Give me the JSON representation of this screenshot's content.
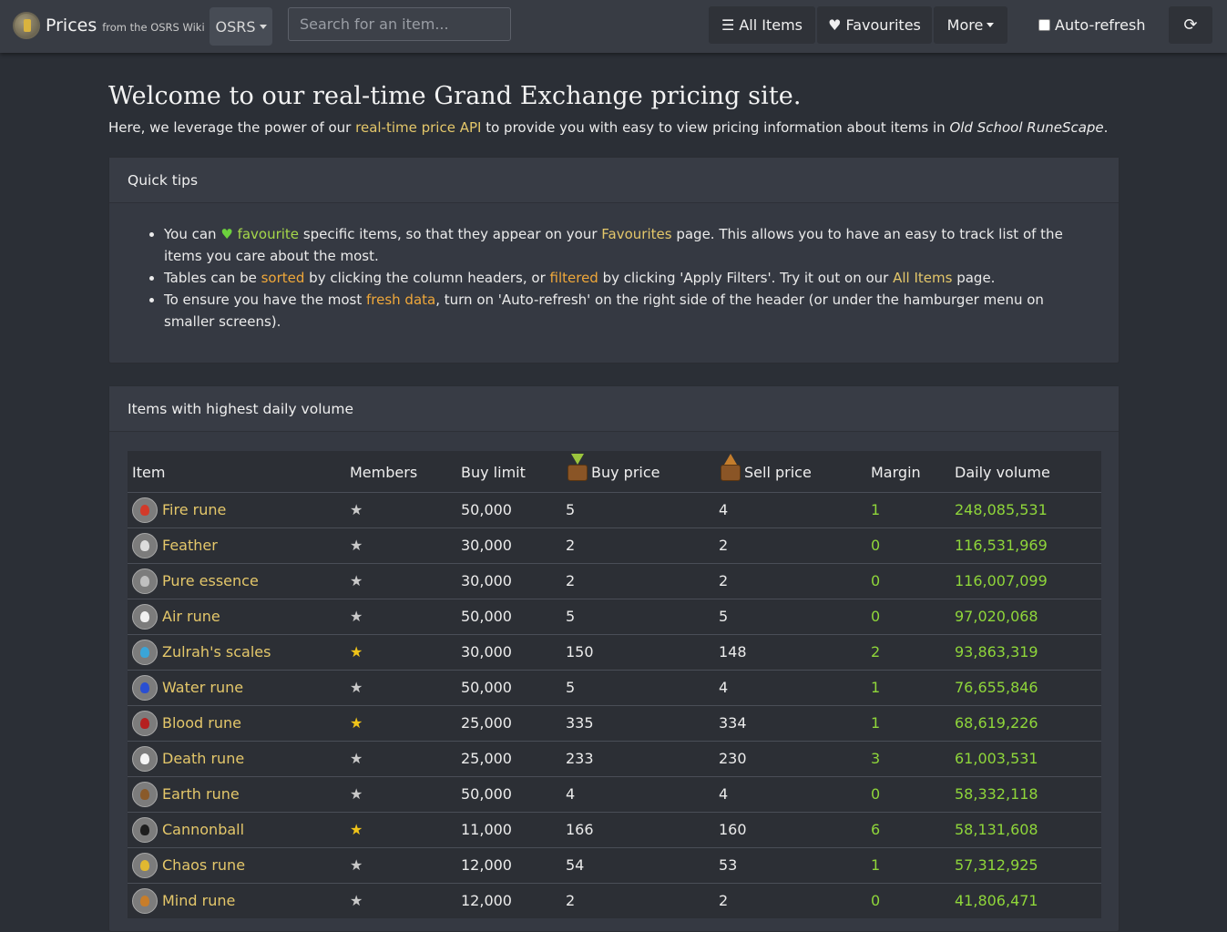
{
  "nav": {
    "brand_title": "Prices",
    "brand_subtitle": "from the OSRS Wiki",
    "game_select": "OSRS",
    "search_placeholder": "Search for an item...",
    "all_items": "All Items",
    "favourites": "Favourites",
    "more": "More",
    "auto_refresh": "Auto-refresh"
  },
  "welcome": {
    "title": "Welcome to our real-time Grand Exchange pricing site.",
    "intro_before": "Here, we leverage the power of our ",
    "intro_link": "real-time price API",
    "intro_middle": " to provide you with easy to view pricing information about items in ",
    "intro_game": "Old School RuneScape",
    "intro_end": "."
  },
  "tips": {
    "header": "Quick tips",
    "tip1_a": "You can ",
    "tip1_link": "favourite",
    "tip1_b": " specific items, so that they appear on your ",
    "tip1_link2": "Favourites",
    "tip1_c": " page. This allows you to have an easy to track list of the items you care about the most.",
    "tip2_a": "Tables can be ",
    "tip2_link": "sorted",
    "tip2_b": " by clicking the column headers, or ",
    "tip2_link2": "filtered",
    "tip2_c": " by clicking 'Apply Filters'. Try it out on our ",
    "tip2_link3": "All Items",
    "tip2_d": " page.",
    "tip3_a": "To ensure you have the most ",
    "tip3_link": "fresh data",
    "tip3_b": ", turn on 'Auto-refresh' on the right side of the header (or under the hamburger menu on smaller screens)."
  },
  "volume": {
    "header": "Items with highest daily volume",
    "columns": [
      "Item",
      "Members",
      "Buy limit",
      "Buy price",
      "Sell price",
      "Margin",
      "Daily volume"
    ],
    "rows": [
      {
        "name": "Fire rune",
        "members": false,
        "limit": "50,000",
        "buy": "5",
        "sell": "4",
        "margin": "1",
        "volume": "248,085,531",
        "icon": "fire-rune-icon",
        "color": "#d23a2a"
      },
      {
        "name": "Feather",
        "members": false,
        "limit": "30,000",
        "buy": "2",
        "sell": "2",
        "margin": "0",
        "volume": "116,531,969",
        "icon": "feather-icon",
        "color": "#dcdcdc"
      },
      {
        "name": "Pure essence",
        "members": false,
        "limit": "30,000",
        "buy": "2",
        "sell": "2",
        "margin": "0",
        "volume": "116,007,099",
        "icon": "pure-essence-icon",
        "color": "#bfbfbf"
      },
      {
        "name": "Air rune",
        "members": false,
        "limit": "50,000",
        "buy": "5",
        "sell": "5",
        "margin": "0",
        "volume": "97,020,068",
        "icon": "air-rune-icon",
        "color": "#f0f0f0"
      },
      {
        "name": "Zulrah's scales",
        "members": true,
        "limit": "30,000",
        "buy": "150",
        "sell": "148",
        "margin": "2",
        "volume": "93,863,319",
        "icon": "zulrahs-scales-icon",
        "color": "#3aa5d8"
      },
      {
        "name": "Water rune",
        "members": false,
        "limit": "50,000",
        "buy": "5",
        "sell": "4",
        "margin": "1",
        "volume": "76,655,846",
        "icon": "water-rune-icon",
        "color": "#2a4fd2"
      },
      {
        "name": "Blood rune",
        "members": true,
        "limit": "25,000",
        "buy": "335",
        "sell": "334",
        "margin": "1",
        "volume": "68,619,226",
        "icon": "blood-rune-icon",
        "color": "#b52020"
      },
      {
        "name": "Death rune",
        "members": false,
        "limit": "25,000",
        "buy": "233",
        "sell": "230",
        "margin": "3",
        "volume": "61,003,531",
        "icon": "death-rune-icon",
        "color": "#f5f5f5"
      },
      {
        "name": "Earth rune",
        "members": false,
        "limit": "50,000",
        "buy": "4",
        "sell": "4",
        "margin": "0",
        "volume": "58,332,118",
        "icon": "earth-rune-icon",
        "color": "#8a5a2a"
      },
      {
        "name": "Cannonball",
        "members": true,
        "limit": "11,000",
        "buy": "166",
        "sell": "160",
        "margin": "6",
        "volume": "58,131,608",
        "icon": "cannonball-icon",
        "color": "#1e1e1e"
      },
      {
        "name": "Chaos rune",
        "members": false,
        "limit": "12,000",
        "buy": "54",
        "sell": "53",
        "margin": "1",
        "volume": "57,312,925",
        "icon": "chaos-rune-icon",
        "color": "#e0b830"
      },
      {
        "name": "Mind rune",
        "members": false,
        "limit": "12,000",
        "buy": "2",
        "sell": "2",
        "margin": "0",
        "volume": "41,806,471",
        "icon": "mind-rune-icon",
        "color": "#c77d2a"
      }
    ]
  }
}
